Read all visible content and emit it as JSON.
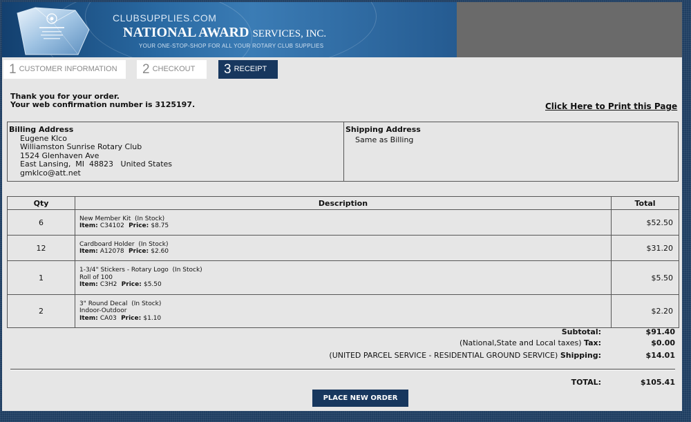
{
  "header": {
    "site": "CLUBSUPPLIES.COM",
    "company_main": "NATIONAL AWARD",
    "company_rest": "SERVICES, INC.",
    "tagline": "YOUR ONE-STOP-SHOP FOR ALL YOUR ROTARY CLUB SUPPLIES"
  },
  "steps": [
    {
      "num": "1",
      "label": "CUSTOMER INFORMATION",
      "active": false
    },
    {
      "num": "2",
      "label": "CHECKOUT",
      "active": false
    },
    {
      "num": "3",
      "label": "RECEIPT",
      "active": true
    }
  ],
  "confirmation": {
    "thanks": "Thank you for your order.",
    "number_line": "Your web confirmation number is 3125197.",
    "print_link": "Click Here to Print this Page"
  },
  "billing": {
    "title": "Billing Address",
    "lines": [
      "Eugene Klco",
      "Williamston Sunrise Rotary Club",
      "1524 Glenhaven Ave",
      "East Lansing,  MI  48823   United States",
      "gmklco@att.net"
    ]
  },
  "shipping": {
    "title": "Shipping Address",
    "lines": [
      "Same as Billing"
    ]
  },
  "table": {
    "headers": {
      "qty": "Qty",
      "description": "Description",
      "total": "Total"
    },
    "rows": [
      {
        "qty": "6",
        "name": "New Member Kit  (In Stock)",
        "extra": "",
        "item_label": "Item:",
        "item": "C34102",
        "price_label": "Price:",
        "price": "$8.75",
        "total": "$52.50"
      },
      {
        "qty": "12",
        "name": "Cardboard Holder  (In Stock)",
        "extra": "",
        "item_label": "Item:",
        "item": "A12078",
        "price_label": "Price:",
        "price": "$2.60",
        "total": "$31.20"
      },
      {
        "qty": "1",
        "name": "1-3/4\" Stickers - Rotary Logo  (In Stock)",
        "extra": "Roll of 100",
        "item_label": "Item:",
        "item": "C3H2",
        "price_label": "Price:",
        "price": "$5.50",
        "total": "$5.50"
      },
      {
        "qty": "2",
        "name": "3\" Round Decal  (In Stock)",
        "extra": "Indoor-Outdoor",
        "item_label": "Item:",
        "item": "CA03",
        "price_label": "Price:",
        "price": "$1.10",
        "total": "$2.20"
      }
    ]
  },
  "totals": {
    "subtotal_label": "Subtotal:",
    "subtotal": "$91.40",
    "tax_note": "(National,State and Local taxes)",
    "tax_label": "Tax:",
    "tax": "$0.00",
    "shipping_note": "(UNITED PARCEL SERVICE - RESIDENTIAL GROUND SERVICE)",
    "shipping_label": "Shipping:",
    "shipping": "$14.01",
    "total_label": "TOTAL:",
    "total": "$105.41"
  },
  "actions": {
    "place_order": "PLACE NEW ORDER"
  },
  "colors": {
    "navy": "#17375e",
    "page_bg": "#e6e6e6",
    "outer_bg": "#1f3e62"
  }
}
